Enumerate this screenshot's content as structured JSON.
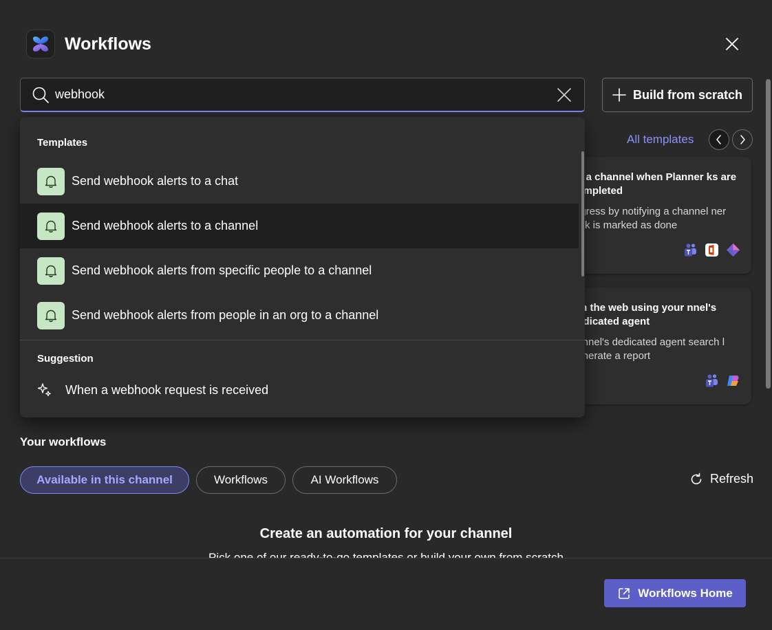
{
  "header": {
    "title": "Workflows"
  },
  "search": {
    "value": "webhook",
    "placeholder": ""
  },
  "toolbar": {
    "build_label": "Build from scratch"
  },
  "gallery": {
    "all_templates_label": "All templates",
    "cards": [
      {
        "title": "ify a channel when Planner ks are completed",
        "description": "rogress by notifying a channel ner task is marked as done",
        "icons": [
          "teams-icon",
          "office-icon",
          "planner-icon"
        ]
      },
      {
        "title": "rch the web using your nnel's dedicated agent",
        "description": "hannel's dedicated agent search l generate a report",
        "icons": [
          "teams-icon",
          "copilot-icon"
        ]
      }
    ]
  },
  "dropdown": {
    "templates_heading": "Templates",
    "templates": [
      {
        "label": "Send webhook alerts to a chat",
        "icon": "bell-icon"
      },
      {
        "label": "Send webhook alerts to a channel",
        "icon": "bell-icon"
      },
      {
        "label": "Send webhook alerts from specific people to a channel",
        "icon": "bell-icon"
      },
      {
        "label": "Send webhook alerts from people in an org to a channel",
        "icon": "bell-icon"
      }
    ],
    "suggestion_heading": "Suggestion",
    "suggestion": {
      "label": "When a webhook request is received",
      "icon": "sparkle-icon"
    }
  },
  "your_workflows": {
    "heading": "Your workflows",
    "filters": [
      "Available in this channel",
      "Workflows",
      "AI Workflows"
    ],
    "selected_filter": "Available in this channel",
    "refresh_label": "Refresh"
  },
  "empty_state": {
    "title": "Create an automation for your channel",
    "subtitle": "Pick one of our ready-to-go templates or build your own from scratch"
  },
  "footer": {
    "home_label": "Workflows Home"
  },
  "colors": {
    "background": "#292929",
    "accent": "#5b5fc7",
    "accent_text": "#8c91f7",
    "template_icon_bg": "#c7e6c4"
  }
}
